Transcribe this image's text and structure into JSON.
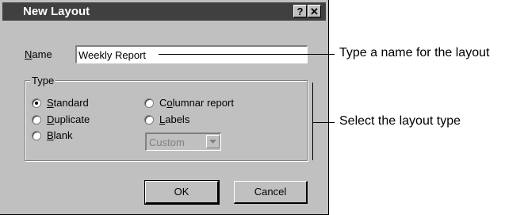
{
  "dialog": {
    "title": "New Layout",
    "help_label": "?",
    "close_label": "✕",
    "name_label_accel": "N",
    "name_label_rest": "ame",
    "name_value": "Weekly Report",
    "type_group_label": "Type",
    "options": {
      "standard": {
        "accel": "S",
        "rest": "tandard",
        "selected": true
      },
      "duplicate": {
        "accel": "D",
        "rest": "uplicate",
        "selected": false
      },
      "blank": {
        "accel": "B",
        "rest": "lank",
        "selected": false
      },
      "columnar_pre": "C",
      "columnar_accel": "o",
      "columnar_rest": "lumnar report",
      "labels": {
        "accel": "L",
        "rest": "abels",
        "selected": false
      }
    },
    "label_format_value": "Custom",
    "ok_label": "OK",
    "cancel_label": "Cancel"
  },
  "annotations": {
    "name_hint": "Type a name for the layout",
    "type_hint": "Select the layout type"
  }
}
